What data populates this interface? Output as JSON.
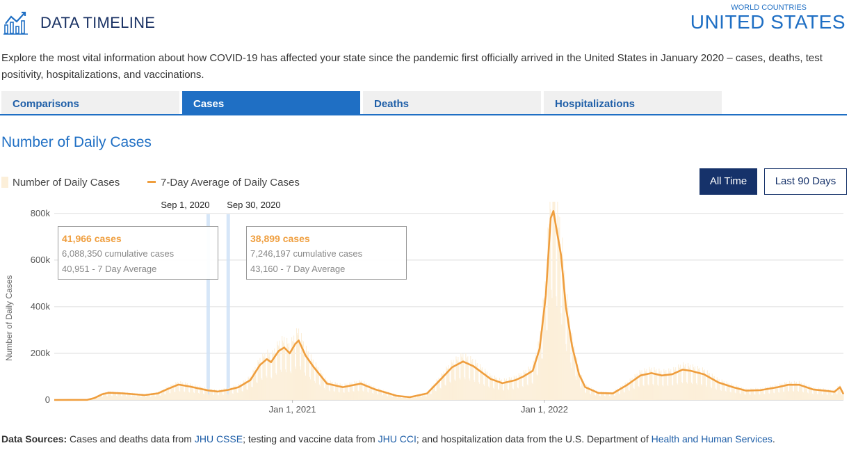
{
  "header": {
    "title": "DATA TIMELINE",
    "country_kicker": "WORLD COUNTRIES",
    "country_name": "UNITED STATES"
  },
  "intro": "Explore the most vital information about how COVID-19 has affected your state since the pandemic first officially arrived in the United States in January 2020 – cases, deaths, test positivity, hospitalizations, and vaccinations.",
  "tabs": [
    {
      "label": "Comparisons",
      "active": false
    },
    {
      "label": "Cases",
      "active": true
    },
    {
      "label": "Deaths",
      "active": false
    },
    {
      "label": "Hospitalizations",
      "active": false
    }
  ],
  "section_title": "Number of Daily Cases",
  "legend": {
    "bars": "Number of Daily Cases",
    "line": "7-Day Average of Daily Cases"
  },
  "range_buttons": {
    "all_time": "All Time",
    "last_90": "Last 90 Days",
    "selected": "all_time"
  },
  "tooltips": [
    {
      "date_label": "Sep 1, 2020",
      "cases": "41,966 cases",
      "cumulative": "6,088,350 cumulative cases",
      "average": "40,951 - 7 Day Average"
    },
    {
      "date_label": "Sep 30, 2020",
      "cases": "38,899 cases",
      "cumulative": "7,246,197 cumulative cases",
      "average": "43,160 - 7 Day Average"
    }
  ],
  "sources": {
    "prefix": "Data Sources:",
    "t1": "Cases and deaths data from",
    "l1": "JHU CSSE",
    "t2": "; testing and vaccine data from",
    "l2": "JHU CCI",
    "t3": "; and hospitalization data from the U.S. Department of",
    "l3": "Health and Human Services",
    "t4": "."
  },
  "colors": {
    "brand_blue": "#1f6fc4",
    "navy": "#16326a",
    "average_line": "#ef9e3e",
    "daily_bars": "#fcefd9",
    "highlight": "#cfe2f7"
  },
  "chart_data": {
    "type": "line",
    "x_type": "date",
    "xlim": [
      "2020-01-22",
      "2023-03-10"
    ],
    "ylim": [
      0,
      850000
    ],
    "ylabel": "Number of Daily Cases",
    "yticks": [
      0,
      200000,
      400000,
      600000,
      800000
    ],
    "ytick_labels": [
      "0",
      "200k",
      "400k",
      "600k",
      "800k"
    ],
    "xticks": [
      "2021-01-01",
      "2022-01-01"
    ],
    "xtick_labels": [
      "Jan 1, 2021",
      "Jan 1, 2022"
    ],
    "grid": "horizontal",
    "legend_position": "top-left",
    "highlighted_dates": [
      "2020-09-01",
      "2020-09-30"
    ],
    "series": [
      {
        "name": "7-Day Average of Daily Cases",
        "style": "line",
        "points": [
          [
            "2020-01-22",
            0
          ],
          [
            "2020-03-10",
            500
          ],
          [
            "2020-03-20",
            8000
          ],
          [
            "2020-04-01",
            25000
          ],
          [
            "2020-04-10",
            31000
          ],
          [
            "2020-05-01",
            28000
          ],
          [
            "2020-06-01",
            21000
          ],
          [
            "2020-06-20",
            28000
          ],
          [
            "2020-07-05",
            48000
          ],
          [
            "2020-07-20",
            66000
          ],
          [
            "2020-08-05",
            58000
          ],
          [
            "2020-09-01",
            40951
          ],
          [
            "2020-09-15",
            36000
          ],
          [
            "2020-09-30",
            43160
          ],
          [
            "2020-10-15",
            55000
          ],
          [
            "2020-11-01",
            85000
          ],
          [
            "2020-11-15",
            150000
          ],
          [
            "2020-11-25",
            175000
          ],
          [
            "2020-12-01",
            162000
          ],
          [
            "2020-12-12",
            210000
          ],
          [
            "2020-12-20",
            225000
          ],
          [
            "2020-12-28",
            200000
          ],
          [
            "2021-01-05",
            240000
          ],
          [
            "2021-01-10",
            255000
          ],
          [
            "2021-01-20",
            190000
          ],
          [
            "2021-02-01",
            140000
          ],
          [
            "2021-02-20",
            70000
          ],
          [
            "2021-03-15",
            55000
          ],
          [
            "2021-04-10",
            70000
          ],
          [
            "2021-05-01",
            45000
          ],
          [
            "2021-06-01",
            18000
          ],
          [
            "2021-06-20",
            12000
          ],
          [
            "2021-07-15",
            28000
          ],
          [
            "2021-08-01",
            80000
          ],
          [
            "2021-08-20",
            140000
          ],
          [
            "2021-09-05",
            165000
          ],
          [
            "2021-09-20",
            145000
          ],
          [
            "2021-10-15",
            90000
          ],
          [
            "2021-11-01",
            72000
          ],
          [
            "2021-11-20",
            85000
          ],
          [
            "2021-12-01",
            100000
          ],
          [
            "2021-12-15",
            125000
          ],
          [
            "2021-12-25",
            220000
          ],
          [
            "2022-01-03",
            450000
          ],
          [
            "2022-01-10",
            780000
          ],
          [
            "2022-01-14",
            810000
          ],
          [
            "2022-01-18",
            740000
          ],
          [
            "2022-01-25",
            620000
          ],
          [
            "2022-02-01",
            400000
          ],
          [
            "2022-02-10",
            230000
          ],
          [
            "2022-02-20",
            110000
          ],
          [
            "2022-03-01",
            55000
          ],
          [
            "2022-03-20",
            30000
          ],
          [
            "2022-04-10",
            28000
          ],
          [
            "2022-05-01",
            65000
          ],
          [
            "2022-05-20",
            105000
          ],
          [
            "2022-06-05",
            115000
          ],
          [
            "2022-06-20",
            105000
          ],
          [
            "2022-07-05",
            110000
          ],
          [
            "2022-07-20",
            130000
          ],
          [
            "2022-08-01",
            125000
          ],
          [
            "2022-08-20",
            110000
          ],
          [
            "2022-09-10",
            75000
          ],
          [
            "2022-10-01",
            55000
          ],
          [
            "2022-10-20",
            40000
          ],
          [
            "2022-11-10",
            42000
          ],
          [
            "2022-12-05",
            55000
          ],
          [
            "2022-12-20",
            65000
          ],
          [
            "2023-01-05",
            65000
          ],
          [
            "2023-01-25",
            45000
          ],
          [
            "2023-02-10",
            40000
          ],
          [
            "2023-02-25",
            35000
          ],
          [
            "2023-03-05",
            55000
          ],
          [
            "2023-03-10",
            25000
          ]
        ]
      }
    ]
  }
}
